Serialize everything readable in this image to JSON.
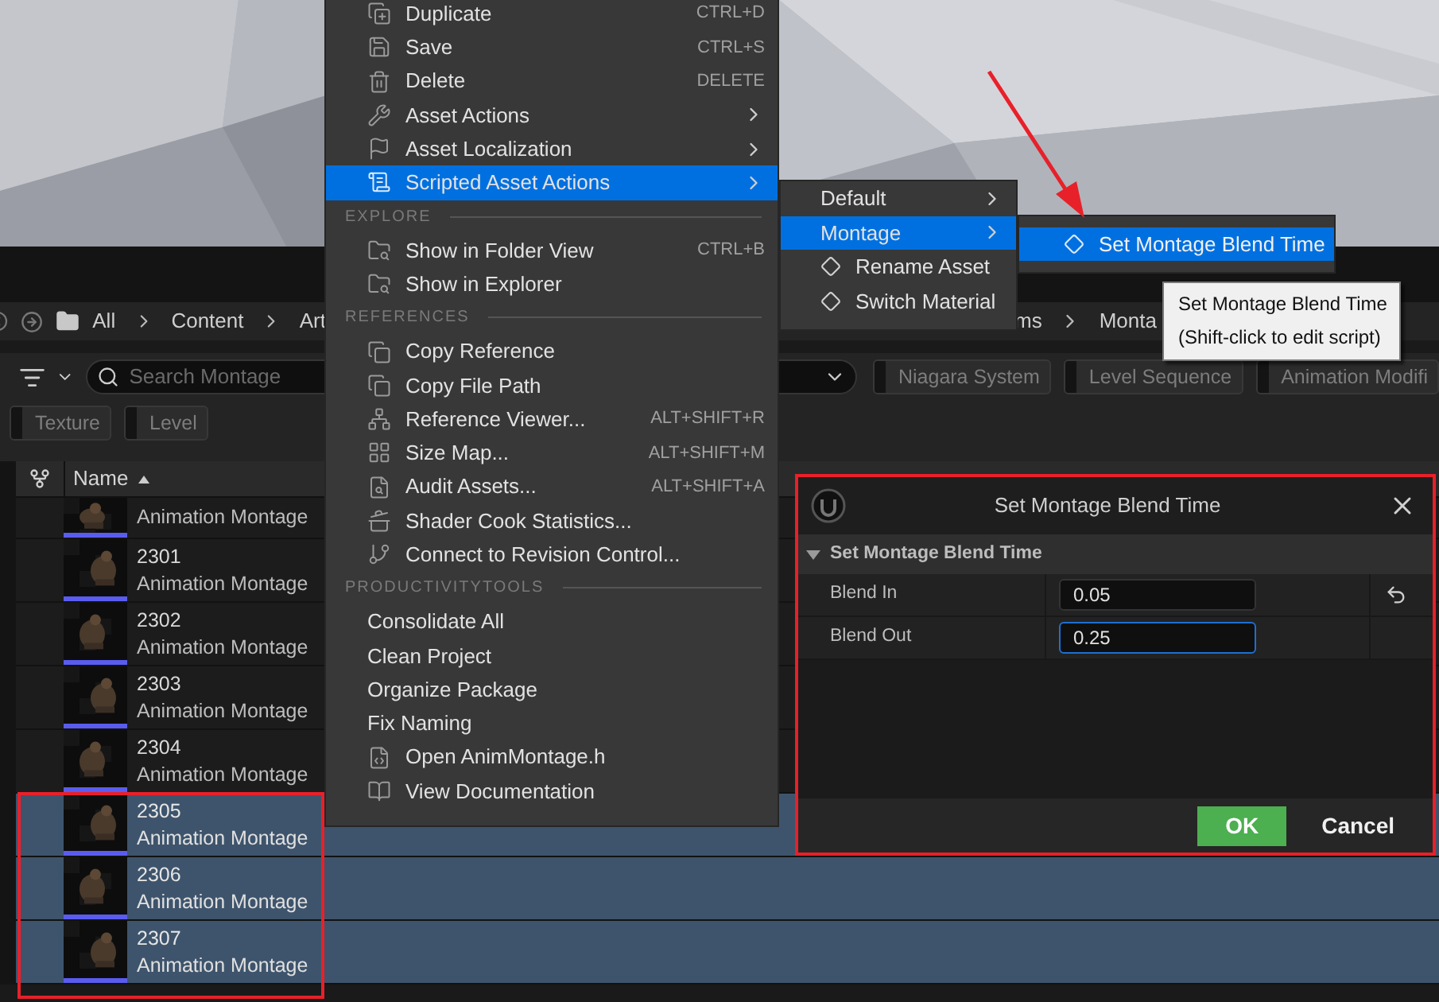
{
  "breadcrumb": {
    "leading": [
      "All",
      "Content",
      "Art"
    ],
    "trailing": [
      "ms",
      "Monta"
    ]
  },
  "search": {
    "placeholder": "Search Montage"
  },
  "filters": {
    "top_row": [
      "Niagara System",
      "Level Sequence",
      "Animation Modifi"
    ],
    "bottom_row": [
      "Texture",
      "Level"
    ]
  },
  "table": {
    "columns": [
      "Name"
    ],
    "rows": [
      {
        "type": "Animation Montage",
        "selected": false
      },
      {
        "name": "2301",
        "type": "Animation Montage",
        "selected": false
      },
      {
        "name": "2302",
        "type": "Animation Montage",
        "selected": false
      },
      {
        "name": "2303",
        "type": "Animation Montage",
        "selected": false
      },
      {
        "name": "2304",
        "type": "Animation Montage",
        "selected": false
      },
      {
        "name": "2305",
        "type": "Animation Montage",
        "selected": true
      },
      {
        "name": "2306",
        "type": "Animation Montage",
        "selected": true
      },
      {
        "name": "2307",
        "type": "Animation Montage",
        "selected": true
      }
    ]
  },
  "context_menu": {
    "items": [
      {
        "kind": "item",
        "label": "Duplicate",
        "shortcut": "CTRL+D",
        "submenu": false,
        "selected": false
      },
      {
        "kind": "item",
        "label": "Save",
        "shortcut": "CTRL+S",
        "submenu": false,
        "selected": false
      },
      {
        "kind": "item",
        "label": "Delete",
        "shortcut": "DELETE",
        "submenu": false,
        "selected": false
      },
      {
        "kind": "item",
        "label": "Asset Actions",
        "submenu": true,
        "selected": false
      },
      {
        "kind": "item",
        "label": "Asset Localization",
        "submenu": true,
        "selected": false
      },
      {
        "kind": "item",
        "label": "Scripted Asset Actions",
        "submenu": true,
        "selected": true
      },
      {
        "kind": "header",
        "label": "EXPLORE"
      },
      {
        "kind": "item",
        "label": "Show in Folder View",
        "shortcut": "CTRL+B",
        "submenu": false,
        "selected": false
      },
      {
        "kind": "item",
        "label": "Show in Explorer",
        "submenu": false,
        "selected": false
      },
      {
        "kind": "header",
        "label": "REFERENCES"
      },
      {
        "kind": "item",
        "label": "Copy Reference",
        "submenu": false,
        "selected": false
      },
      {
        "kind": "item",
        "label": "Copy File Path",
        "submenu": false,
        "selected": false
      },
      {
        "kind": "item",
        "label": "Reference Viewer...",
        "shortcut": "ALT+SHIFT+R",
        "submenu": false,
        "selected": false
      },
      {
        "kind": "item",
        "label": "Size Map...",
        "shortcut": "ALT+SHIFT+M",
        "submenu": false,
        "selected": false
      },
      {
        "kind": "item",
        "label": "Audit Assets...",
        "shortcut": "ALT+SHIFT+A",
        "submenu": false,
        "selected": false
      },
      {
        "kind": "item",
        "label": "Shader Cook Statistics...",
        "submenu": false,
        "selected": false
      },
      {
        "kind": "item",
        "label": "Connect to Revision Control...",
        "submenu": false,
        "selected": false
      },
      {
        "kind": "header",
        "label": "PRODUCTIVITYTOOLS"
      },
      {
        "kind": "item",
        "label": "Consolidate All",
        "submenu": false,
        "selected": false
      },
      {
        "kind": "item",
        "label": "Clean Project",
        "submenu": false,
        "selected": false
      },
      {
        "kind": "item",
        "label": "Organize Package",
        "submenu": false,
        "selected": false
      },
      {
        "kind": "item",
        "label": "Fix Naming",
        "submenu": false,
        "selected": false
      },
      {
        "kind": "item",
        "label": "Open AnimMontage.h",
        "submenu": false,
        "selected": false
      },
      {
        "kind": "item",
        "label": "View Documentation",
        "submenu": false,
        "selected": false
      }
    ]
  },
  "scripted_submenu": {
    "items": [
      {
        "label": "Default",
        "submenu": true,
        "selected": false
      },
      {
        "label": "Montage",
        "submenu": true,
        "selected": true
      },
      {
        "label": "Rename Asset",
        "submenu": false,
        "selected": false
      },
      {
        "label": "Switch Material",
        "submenu": false,
        "selected": false
      }
    ]
  },
  "montage_submenu": {
    "items": [
      {
        "label": "Set Montage Blend Time",
        "selected": true
      }
    ]
  },
  "tooltip": {
    "lines": [
      "Set Montage Blend Time",
      "(Shift-click to edit script)"
    ]
  },
  "dialog": {
    "title": "Set Montage Blend Time",
    "section": "Set Montage Blend Time",
    "fields": [
      {
        "label": "Blend In",
        "value": "0.05",
        "focused": false,
        "resettable": true
      },
      {
        "label": "Blend Out",
        "value": "0.25",
        "focused": true,
        "resettable": false
      }
    ],
    "buttons": [
      {
        "label": "OK",
        "kind": "primary"
      },
      {
        "label": "Cancel",
        "kind": "secondary"
      }
    ]
  }
}
